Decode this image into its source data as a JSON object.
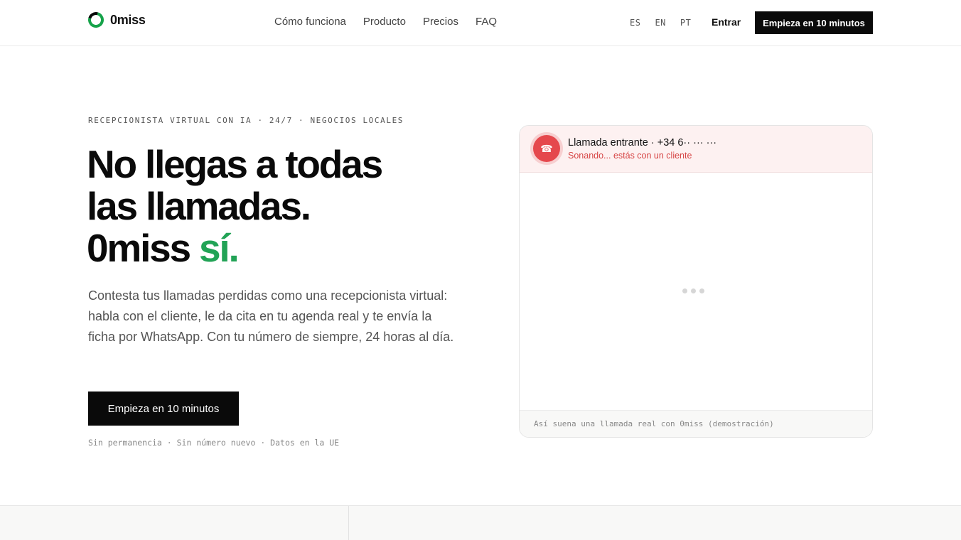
{
  "brand": {
    "name": "0miss",
    "ring_color": "#16a34a"
  },
  "nav": {
    "items": [
      "Cómo funciona",
      "Producto",
      "Precios",
      "FAQ"
    ]
  },
  "langs": [
    "ES",
    "EN",
    "PT"
  ],
  "header": {
    "login": "Entrar",
    "cta": "Empieza en 10 minutos"
  },
  "hero": {
    "eyebrow": "RECEPCIONISTA VIRTUAL CON IA · 24/7 · NEGOCIOS LOCALES",
    "headline_line1": "No llegas a todas",
    "headline_line2": "las llamadas.",
    "headline_brand": "0miss",
    "headline_accent": "sí.",
    "accent_color": "#22a356",
    "lead": "Contesta tus llamadas perdidas como una recepcionista virtual: habla con el cliente, le da cita en tu agenda real y te envía la ficha por WhatsApp. Con tu número de siempre, 24 horas al día.",
    "cta": "Empieza en 10 minutos",
    "trust": "Sin permanencia · Sin número nuevo · Datos en la UE"
  },
  "call_card": {
    "icon": "phone-icon",
    "title": "Llamada entrante · +34 6·· ··· ···",
    "status": "Sonando... estás con un cliente",
    "footer": "Así suena una llamada real con 0miss (demostración)"
  }
}
